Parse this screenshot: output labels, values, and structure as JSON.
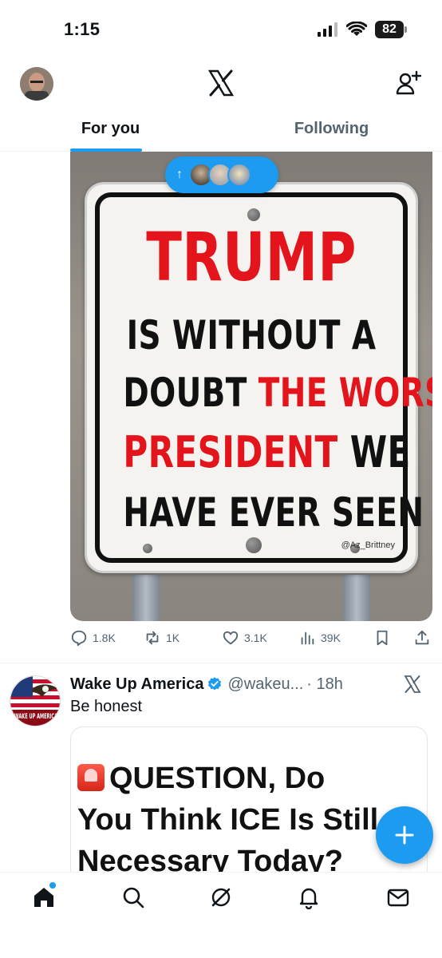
{
  "status_bar": {
    "time": "1:15",
    "battery": "82"
  },
  "header": {
    "tabs": [
      {
        "label": "For you",
        "active": true
      },
      {
        "label": "Following",
        "active": false
      }
    ]
  },
  "post1": {
    "new_posts_pill_arrow": "↑",
    "image": {
      "line1": "TRUMP",
      "line2": "IS WITHOUT A",
      "line3_black": "DOUBT",
      "line3_red": "THE WORST",
      "line4_red": "PRESIDENT",
      "line4_black": "WE",
      "line5": "HAVE EVER SEEN",
      "watermark": "@Az_Brittney"
    },
    "actions": {
      "replies": "1.8K",
      "reposts": "1K",
      "likes": "3.1K",
      "views": "39K"
    }
  },
  "post2": {
    "avatar_text": "WAKE UP AMERICA",
    "name": "Wake Up America",
    "handle": "@wakeu...",
    "time": "· 18h",
    "text": "Be honest",
    "card_line1": "QUESTION, Do",
    "card_line2": "You Think ICE Is Still",
    "card_line3": "Necessary Today?"
  },
  "colors": {
    "accent": "#1d9bf0",
    "red": "#e3141b",
    "muted": "#536471"
  }
}
